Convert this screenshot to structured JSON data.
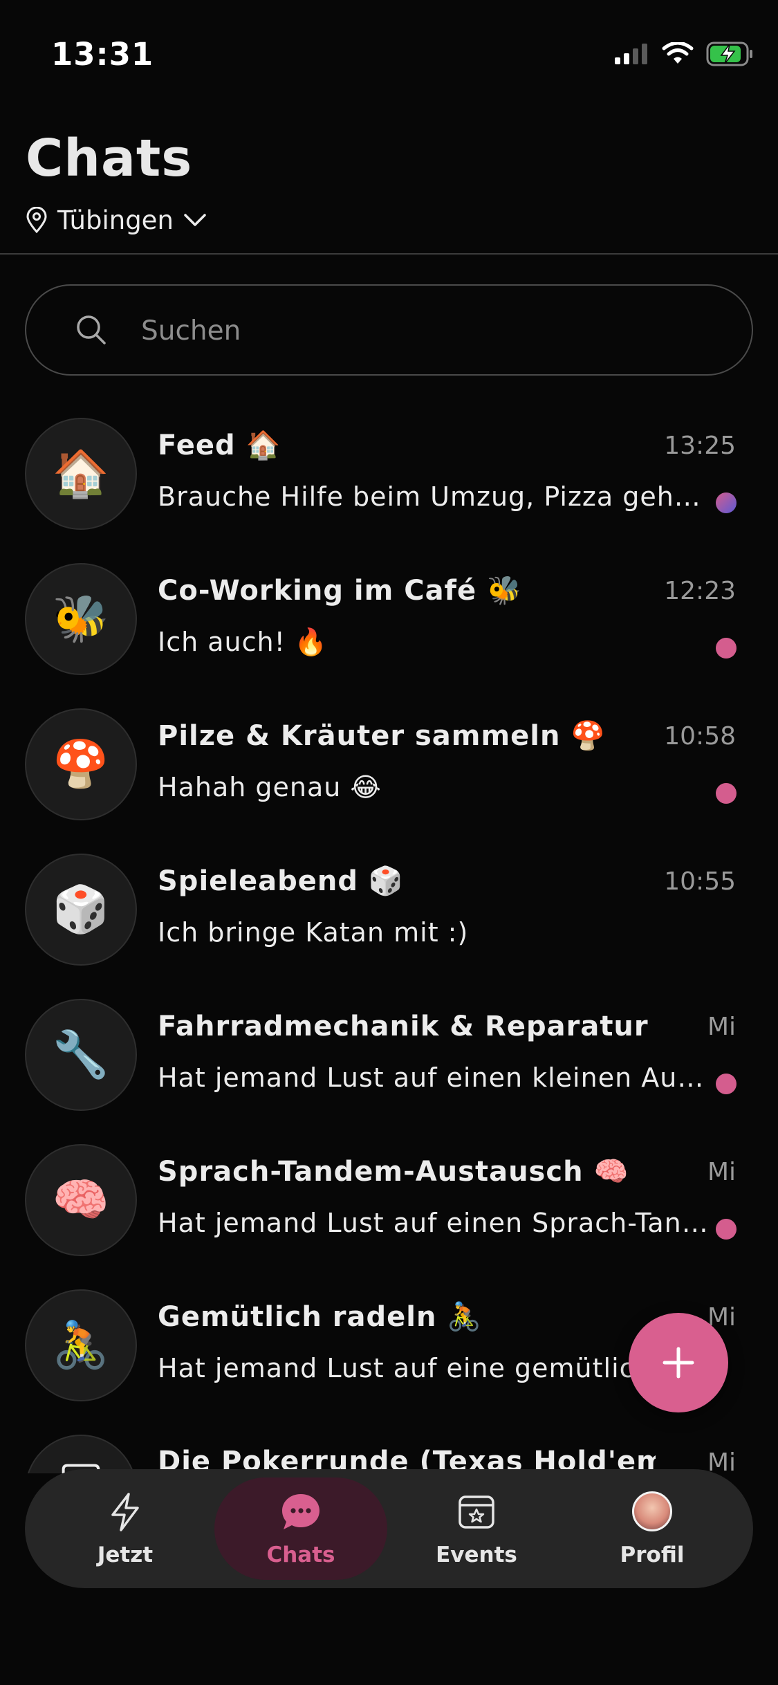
{
  "status_bar": {
    "time": "13:31",
    "icons": [
      "cellular-signal-icon",
      "wifi-icon",
      "battery-charging-icon"
    ]
  },
  "header": {
    "title": "Chats",
    "location": "Tübingen"
  },
  "search": {
    "placeholder": "Suchen"
  },
  "chats": [
    {
      "title": "Feed 🏠",
      "time": "13:25",
      "preview": "Brauche Hilfe beim Umzug, Pizza geht aufs Haus!",
      "avatar": "🏠",
      "unread": true
    },
    {
      "title": "Co-Working im Café 🐝",
      "time": "12:23",
      "preview": "Ich auch! 🔥",
      "avatar": "🐝",
      "unread": true
    },
    {
      "title": "Pilze & Kräuter sammeln 🍄",
      "time": "10:58",
      "preview": "Hahah genau 😂",
      "avatar": "🍄",
      "unread": true
    },
    {
      "title": "Spieleabend 🎲",
      "time": "10:55",
      "preview": "Ich bringe Katan mit :)",
      "avatar": "🎲",
      "unread": false
    },
    {
      "title": "Fahrradmechanik & Reparatur 🔧",
      "time": "Mi",
      "preview": "Hat jemand Lust auf einen kleinen Austausch?",
      "avatar": "🔧",
      "unread": true
    },
    {
      "title": "Sprach-Tandem-Austausch 🧠",
      "time": "Mi",
      "preview": "Hat jemand Lust auf einen Sprach-Tandem-Austausch?",
      "avatar": "🧠",
      "unread": true
    },
    {
      "title": "Gemütlich radeln 🚴",
      "time": "Mi",
      "preview": "Hat jemand Lust auf eine gemütliche Radtour?",
      "avatar": "🚴",
      "unread": false
    },
    {
      "title": "Die Pokerrunde (Texas Hold'em) 🃏",
      "time": "Mi",
      "preview": "",
      "avatar": "🃏",
      "unread": false
    }
  ],
  "colors": {
    "background": "#070707",
    "accent": "#d95f8f",
    "surface": "#262626",
    "muted_text": "#9a9a9a"
  },
  "fab": {
    "icon": "plus-icon"
  },
  "nav": {
    "items": [
      {
        "label": "Jetzt",
        "icon": "lightning-icon",
        "active": false
      },
      {
        "label": "Chats",
        "icon": "chat-bubble-icon",
        "active": true
      },
      {
        "label": "Events",
        "icon": "calendar-star-icon",
        "active": false
      },
      {
        "label": "Profil",
        "icon": "profile-avatar",
        "active": false
      }
    ]
  }
}
